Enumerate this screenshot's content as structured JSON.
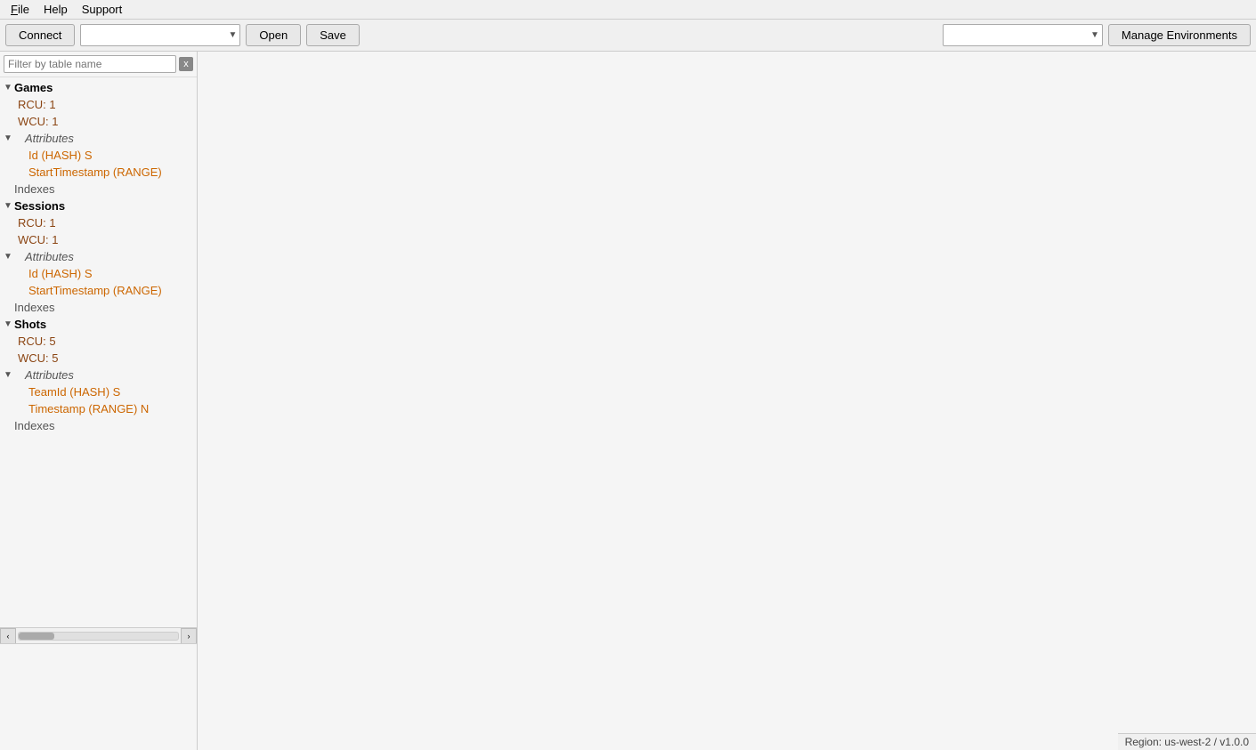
{
  "menubar": {
    "file": "File",
    "help": "Help",
    "support": "Support"
  },
  "toolbar": {
    "connect_label": "Connect",
    "open_label": "Open",
    "save_label": "Save",
    "manage_env_label": "Manage Environments",
    "left_dropdown_placeholder": "",
    "right_dropdown_placeholder": ""
  },
  "sidebar": {
    "filter_placeholder": "Filter by table name",
    "filter_clear": "x",
    "tables": [
      {
        "name": "Games",
        "expanded": true,
        "rcu": "RCU: 1",
        "wcu": "WCU: 1",
        "attributes_label": "Attributes",
        "attributes": [
          "Id (HASH) S",
          "StartTimestamp (RANGE)"
        ],
        "indexes_label": "Indexes"
      },
      {
        "name": "Sessions",
        "expanded": true,
        "rcu": "RCU: 1",
        "wcu": "WCU: 1",
        "attributes_label": "Attributes",
        "attributes": [
          "Id (HASH) S",
          "StartTimestamp (RANGE)"
        ],
        "indexes_label": "Indexes"
      },
      {
        "name": "Shots",
        "expanded": true,
        "rcu": "RCU: 5",
        "wcu": "WCU: 5",
        "attributes_label": "Attributes",
        "attributes": [
          "TeamId (HASH) S",
          "Timestamp (RANGE) N"
        ],
        "indexes_label": "Indexes"
      }
    ]
  },
  "status": {
    "region": "Region: us-west-2 / v1.0.0"
  }
}
